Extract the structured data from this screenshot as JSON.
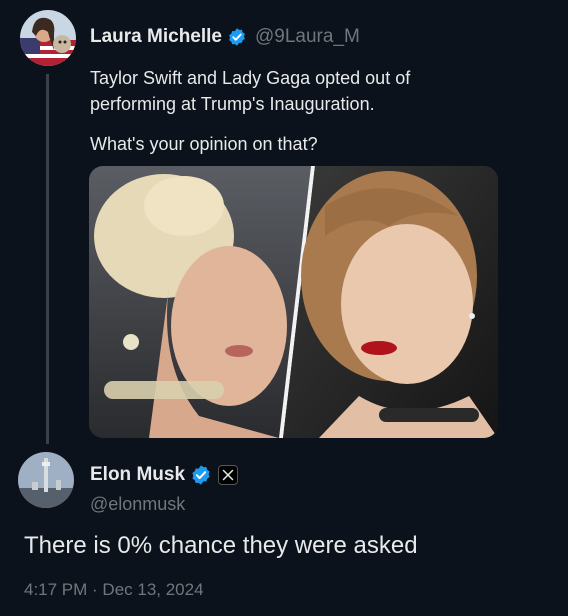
{
  "original_tweet": {
    "display_name": "Laura Michelle",
    "handle": "@9Laura_M",
    "text_line_1": "Taylor Swift and Lady Gaga opted out of",
    "text_line_2": "performing at Trump's Inauguration.",
    "text_line_3": "What's your opinion on that?",
    "media_description": "Side-by-side photo of Lady Gaga and Taylor Swift"
  },
  "reply": {
    "display_name": "Elon Musk",
    "handle": "@elonmusk",
    "text": "There is 0% chance they were asked",
    "timestamp": "4:17 PM · Dec 13, 2024"
  },
  "colors": {
    "background": "#0c121b",
    "text_primary": "#e7e9ea",
    "text_secondary": "#71767b",
    "verified_blue": "#1d9bf0"
  },
  "icons": [
    "verified-badge-icon",
    "x-logo-icon"
  ]
}
